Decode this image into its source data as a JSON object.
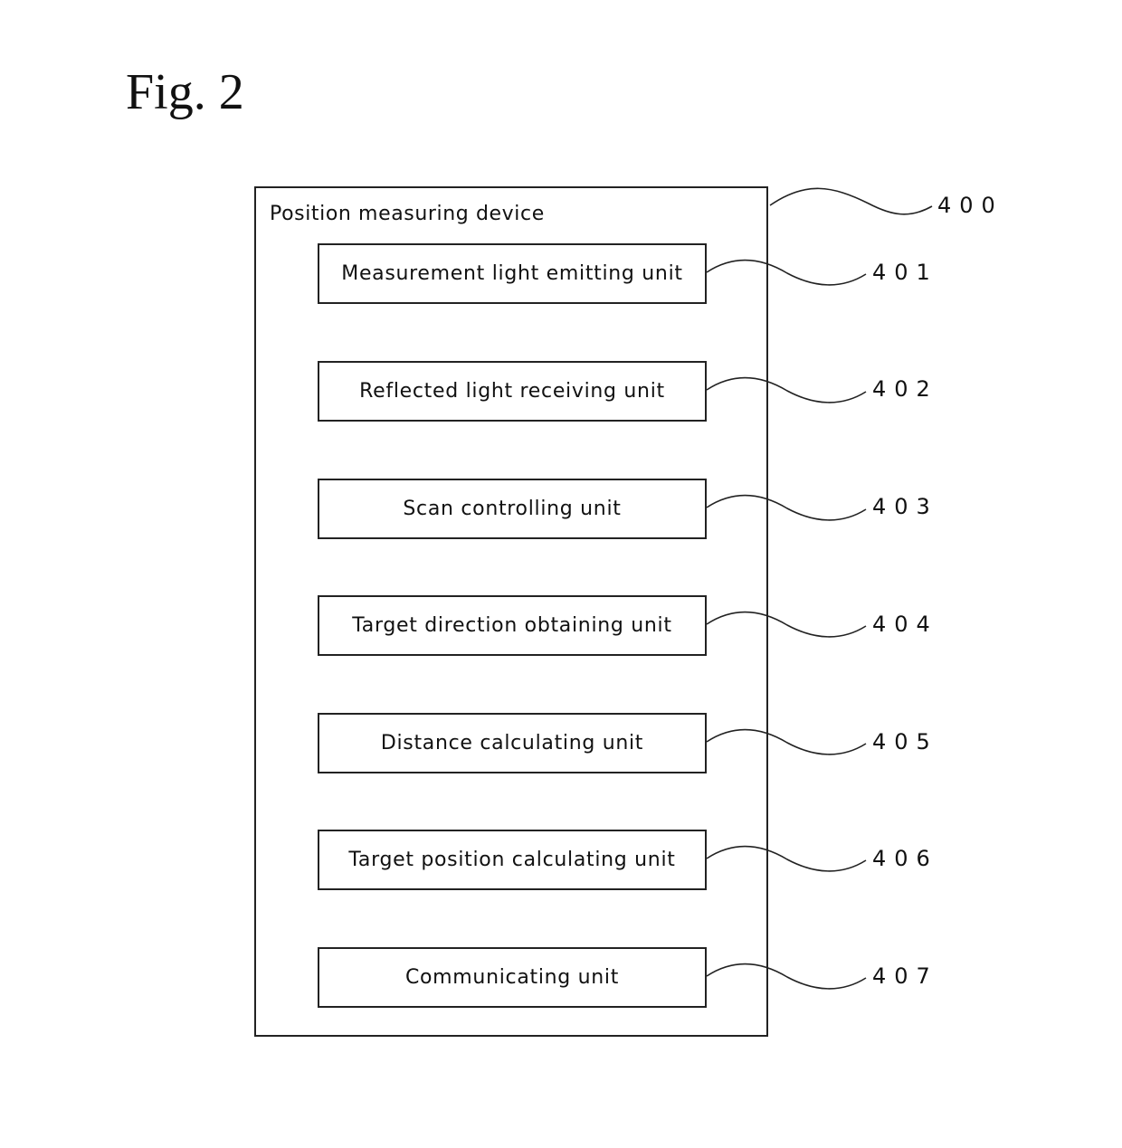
{
  "figure": {
    "title": "Fig. 2"
  },
  "device": {
    "label": "Position measuring device",
    "ref": "400"
  },
  "units": [
    {
      "label": "Measurement light emitting unit",
      "ref": "401"
    },
    {
      "label": "Reflected light receiving unit",
      "ref": "402"
    },
    {
      "label": "Scan controlling unit",
      "ref": "403"
    },
    {
      "label": "Target direction obtaining unit",
      "ref": "404"
    },
    {
      "label": "Distance calculating unit",
      "ref": "405"
    },
    {
      "label": "Target position calculating unit",
      "ref": "406"
    },
    {
      "label": "Communicating unit",
      "ref": "407"
    }
  ]
}
